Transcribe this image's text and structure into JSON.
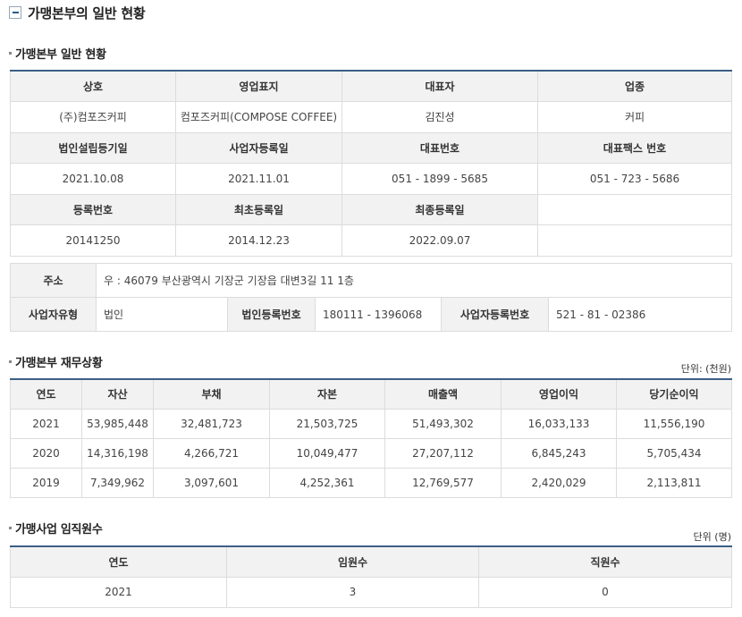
{
  "page_title": "가맹본부의 일반 현황",
  "general": {
    "title": "가맹본부 일반 현황",
    "rows": [
      {
        "type": "header",
        "cells": [
          "상호",
          "영업표지",
          "대표자",
          "업종"
        ]
      },
      {
        "type": "value",
        "cells": [
          "(주)컴포즈커피",
          "컴포즈커피(COMPOSE COFFEE)",
          "김진성",
          "커피"
        ]
      },
      {
        "type": "header",
        "cells": [
          "법인설립등기일",
          "사업자등록일",
          "대표번호",
          "대표팩스 번호"
        ]
      },
      {
        "type": "value",
        "cells": [
          "2021.10.08",
          "2021.11.01",
          "051 - 1899 - 5685",
          "051 - 723 - 5686"
        ]
      },
      {
        "type": "header",
        "cells": [
          "등록번호",
          "최초등록일",
          "최종등록일",
          ""
        ]
      },
      {
        "type": "value",
        "cells": [
          "20141250",
          "2014.12.23",
          "2022.09.07",
          ""
        ]
      }
    ]
  },
  "address": {
    "label": "주소",
    "value": "우 : 46079 부산광역시 기장군 기장읍 대변3길 11 1층",
    "biz_type_label": "사업자유형",
    "biz_type_value": "법인",
    "corp_reg_label": "법인등록번호",
    "corp_reg_value": "180111 - 1396068",
    "biz_reg_label": "사업자등록번호",
    "biz_reg_value": "521 - 81 - 02386"
  },
  "finance": {
    "title": "가맹본부 재무상황",
    "unit": "단위: (천원)",
    "headers": [
      "연도",
      "자산",
      "부채",
      "자본",
      "매출액",
      "영업이익",
      "당기순이익"
    ],
    "rows": [
      [
        "2021",
        "53,985,448",
        "32,481,723",
        "21,503,725",
        "51,493,302",
        "16,033,133",
        "11,556,190"
      ],
      [
        "2020",
        "14,316,198",
        "4,266,721",
        "10,049,477",
        "27,207,112",
        "6,845,243",
        "5,705,434"
      ],
      [
        "2019",
        "7,349,962",
        "3,097,601",
        "4,252,361",
        "12,769,577",
        "2,420,029",
        "2,113,811"
      ]
    ]
  },
  "staff": {
    "title": "가맹사업 임직원수",
    "unit": "단위 (명)",
    "headers": [
      "연도",
      "임원수",
      "직원수"
    ],
    "rows": [
      [
        "2021",
        "3",
        "0"
      ]
    ]
  }
}
